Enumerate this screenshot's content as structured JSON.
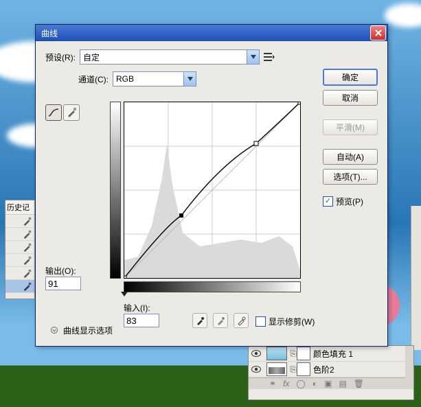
{
  "dialog": {
    "title": "曲线",
    "preset_label": "预设(R):",
    "preset_value": "自定",
    "channel_label": "通道(C):",
    "channel_value": "RGB",
    "output_label": "输出(O):",
    "output_value": "91",
    "input_label": "输入(I):",
    "input_value": "83",
    "show_clipping_label": "显示修剪(W)",
    "disclosure_label": "曲线显示选项"
  },
  "buttons": {
    "ok": "确定",
    "cancel": "取消",
    "smooth": "平滑(M)",
    "auto": "自动(A)",
    "options": "选项(T)...",
    "preview": "预览(P)"
  },
  "history": {
    "title": "历史记"
  },
  "layers": {
    "row1": "颜色填充 1",
    "row2": "色阶2"
  },
  "chart_data": {
    "type": "line",
    "title": "曲线",
    "xlabel": "输入",
    "ylabel": "输出",
    "xlim": [
      0,
      255
    ],
    "ylim": [
      0,
      255
    ],
    "series": [
      {
        "name": "baseline",
        "x": [
          0,
          255
        ],
        "y": [
          0,
          255
        ]
      },
      {
        "name": "curve",
        "x": [
          0,
          83,
          192,
          255
        ],
        "y": [
          0,
          91,
          196,
          255
        ]
      }
    ],
    "points": [
      {
        "x": 0,
        "y": 0
      },
      {
        "x": 83,
        "y": 91
      },
      {
        "x": 192,
        "y": 196
      },
      {
        "x": 255,
        "y": 255
      }
    ],
    "active_point": {
      "input": 83,
      "output": 91
    }
  }
}
